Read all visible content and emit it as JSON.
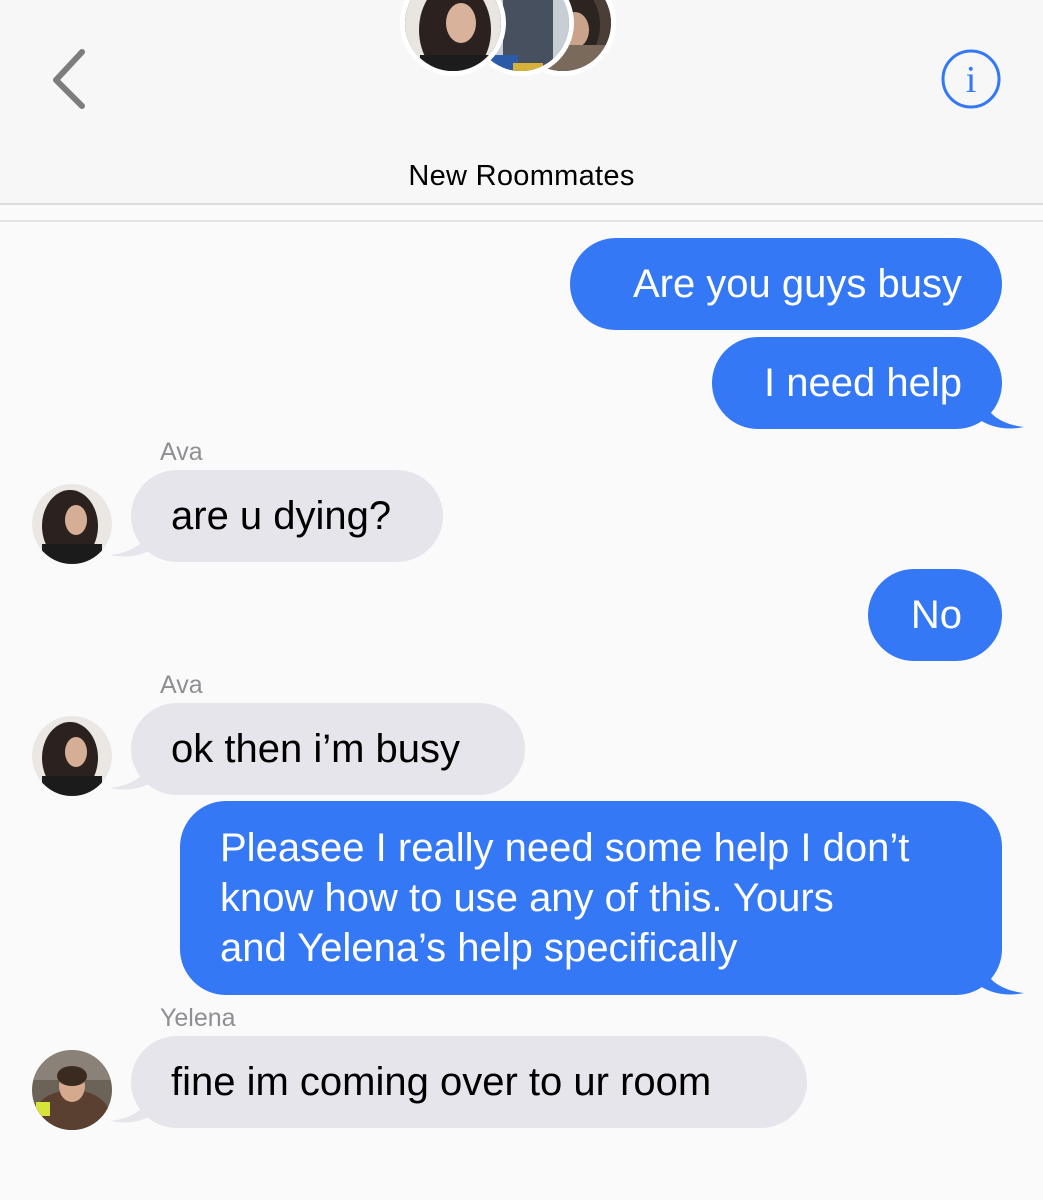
{
  "header": {
    "title": "New Roommates",
    "back_icon": "chevron-left-icon",
    "info_icon": "info-icon",
    "info_glyph": "i",
    "accent_color": "#3478f6"
  },
  "messages": [
    {
      "direction": "outgoing",
      "text": "Are you guys busy"
    },
    {
      "direction": "outgoing",
      "text": "I need help"
    },
    {
      "direction": "incoming",
      "sender": "Ava",
      "text": "are u dying?"
    },
    {
      "direction": "outgoing",
      "text": "No"
    },
    {
      "direction": "incoming",
      "sender": "Ava",
      "text": "ok then i’m busy"
    },
    {
      "direction": "outgoing",
      "lines": [
        "Pleasee I really need some help I don’t",
        "know how to use any of this. Yours",
        "and Yelena’s help specifically"
      ]
    },
    {
      "direction": "incoming",
      "sender": "Yelena",
      "text": "fine im coming over to ur room"
    }
  ],
  "colors": {
    "outgoing_bubble": "#3478f6",
    "incoming_bubble": "#e6e5eb",
    "sender_name": "#8e8e93"
  }
}
